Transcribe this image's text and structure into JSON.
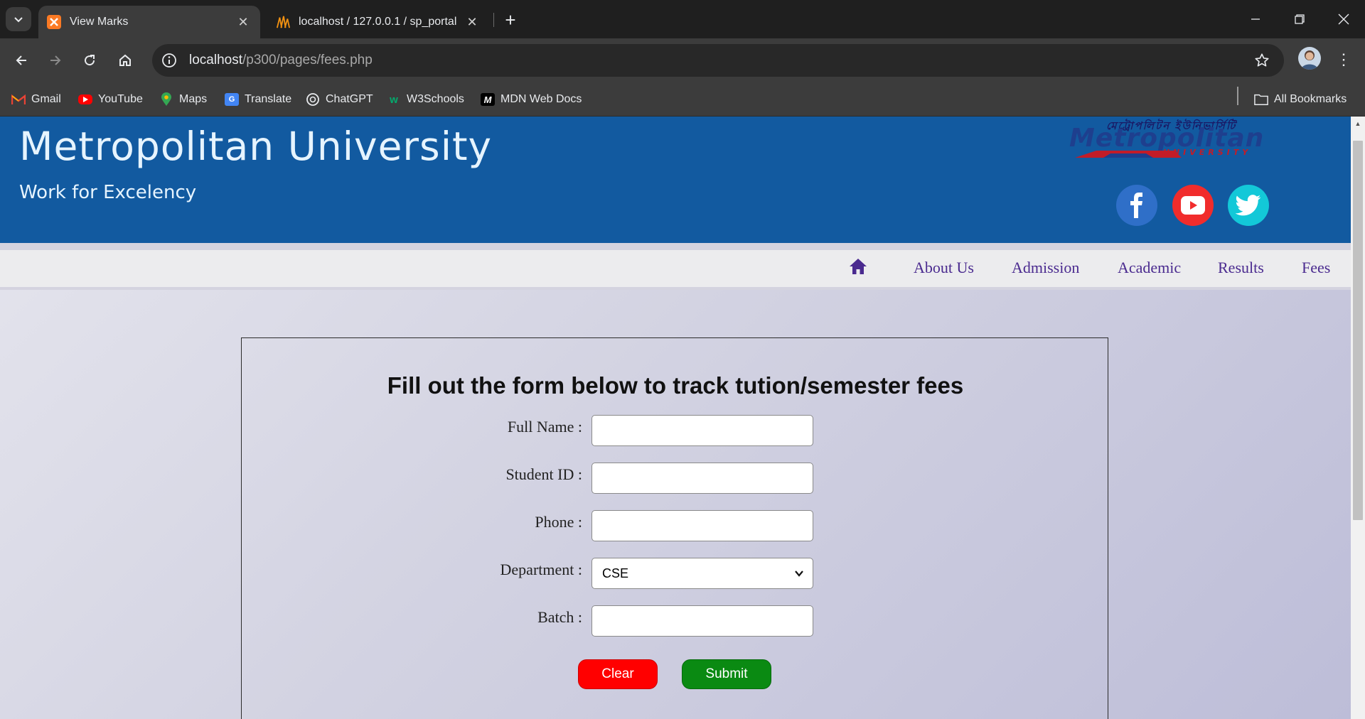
{
  "browser": {
    "tabs": [
      {
        "title": "View Marks",
        "active": true,
        "icon": "xampp-icon"
      },
      {
        "title": "localhost / 127.0.0.1 / sp_portal",
        "active": false,
        "icon": "phpmyadmin-icon"
      }
    ],
    "address": {
      "host": "localhost",
      "path": "/p300/pages/fees.php"
    },
    "bookmarks": [
      "Gmail",
      "YouTube",
      "Maps",
      "Translate",
      "ChatGPT",
      "W3Schools",
      "MDN Web Docs"
    ],
    "all_bookmarks": "All Bookmarks"
  },
  "site": {
    "title": "Metropolitan University",
    "tagline": "Work for Excelency",
    "logo": {
      "bangla": "মেট্রোপলিটন ইউনিভার্সিটি",
      "word": "Metropolitan",
      "sub": "UNIVERSITY"
    },
    "social": [
      "facebook-icon",
      "youtube-icon",
      "twitter-icon"
    ],
    "colors": {
      "header": "#125aa0",
      "nav_link": "#4a2a8f",
      "clear": "#ff0000",
      "submit": "#0a8a12"
    }
  },
  "nav": {
    "items": [
      "About Us",
      "Admission",
      "Academic",
      "Results",
      "Fees"
    ]
  },
  "form": {
    "heading": "Fill out the form below to track tution/semester fees",
    "fields": {
      "full_name": {
        "label": "Full Name :",
        "value": ""
      },
      "student_id": {
        "label": "Student ID :",
        "value": ""
      },
      "phone": {
        "label": "Phone :",
        "value": ""
      },
      "department": {
        "label": "Department :",
        "value": "CSE"
      },
      "batch": {
        "label": "Batch :",
        "value": ""
      }
    },
    "clear_label": "Clear",
    "submit_label": "Submit"
  }
}
